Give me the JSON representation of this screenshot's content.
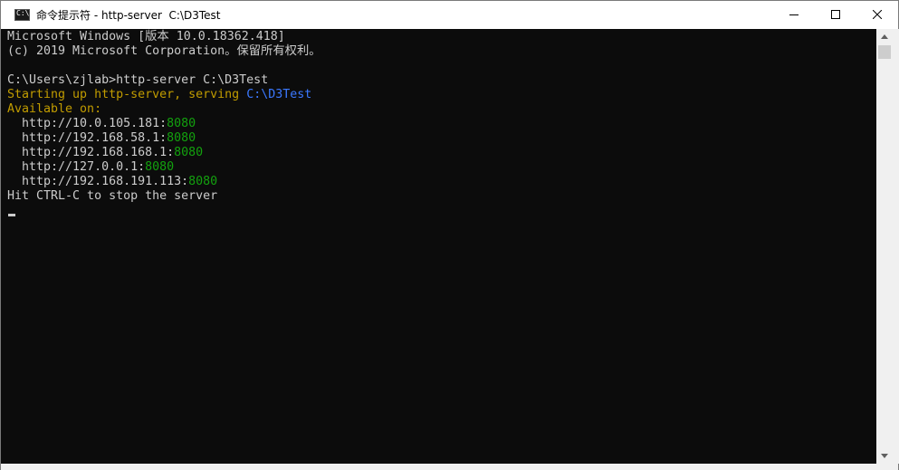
{
  "window": {
    "title": "命令提示符 - http-server  C:\\D3Test",
    "icon": "cmd-icon",
    "controls": [
      "minimize-icon",
      "maximize-icon",
      "close-icon"
    ]
  },
  "console": {
    "banner_line1": "Microsoft Windows [版本 10.0.18362.418]",
    "banner_line2": "(c) 2019 Microsoft Corporation。保留所有权利。",
    "command": "C:\\Users\\zjlab>http-server C:\\D3Test",
    "starting_prefix": "Starting up http-server, serving ",
    "serving_path": "C:\\D3Test",
    "available_on": "Available on:",
    "addresses": [
      {
        "host": "  http://10.0.105.181:",
        "port": "8080"
      },
      {
        "host": "  http://192.168.58.1:",
        "port": "8080"
      },
      {
        "host": "  http://192.168.168.1:",
        "port": "8080"
      },
      {
        "host": "  http://127.0.0.1:",
        "port": "8080"
      },
      {
        "host": "  http://192.168.191.113:",
        "port": "8080"
      }
    ],
    "stop_hint": "Hit CTRL-C to stop the server"
  },
  "colors": {
    "background": "#0c0c0c",
    "default_text": "#cccccc",
    "yellow": "#c19c00",
    "blue": "#3b78ff",
    "green": "#13a10e"
  }
}
